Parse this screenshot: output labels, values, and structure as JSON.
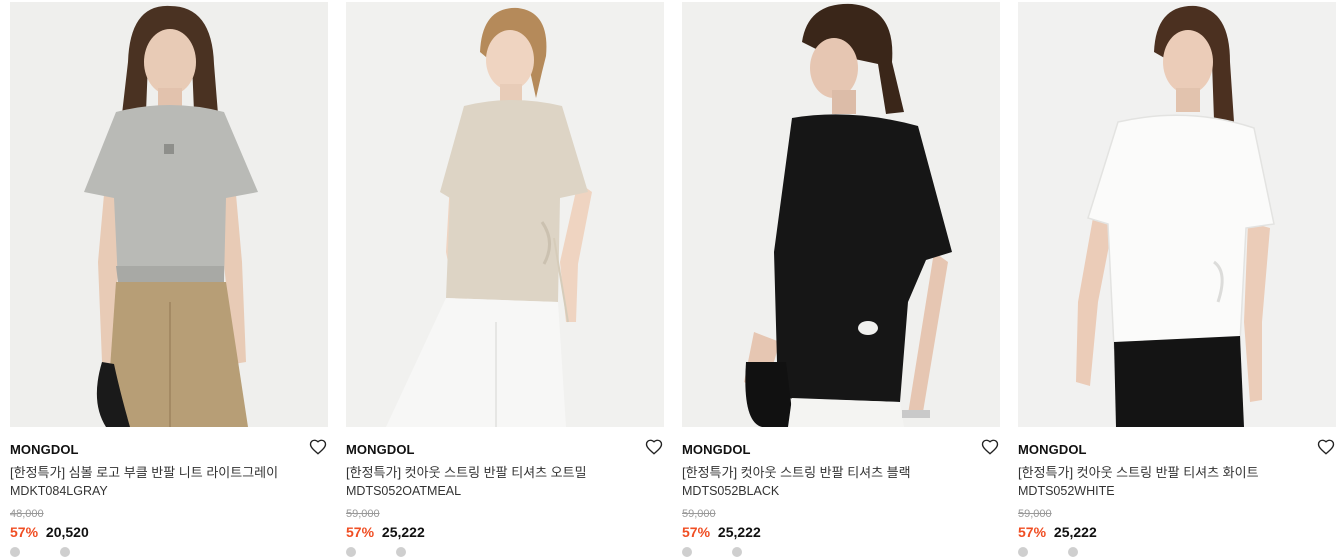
{
  "products": [
    {
      "brand": "MONGDOL",
      "name": "[한정특가] 심볼 로고 부클 반팔 니트 라이트그레이",
      "code": "MDKT084LGRAY",
      "original_price": "48,000",
      "discount": "57%",
      "price": "20,520",
      "photo": {
        "bg": "#efefed",
        "top": "#b9bab6",
        "bottom": "#b79e76",
        "skin": "#e8cbb6",
        "hair": "#4a3222"
      }
    },
    {
      "brand": "MONGDOL",
      "name": "[한정특가] 컷아웃 스트링 반팔 티셔츠 오트밀",
      "code": "MDTS052OATMEAL",
      "original_price": "59,000",
      "discount": "57%",
      "price": "25,222",
      "photo": {
        "bg": "#f1f1ef",
        "top": "#ddd4c5",
        "bottom": "#f7f7f6",
        "skin": "#efd4c1",
        "hair": "#b58a5a"
      }
    },
    {
      "brand": "MONGDOL",
      "name": "[한정특가] 컷아웃 스트링 반팔 티셔츠 블랙",
      "code": "MDTS052BLACK",
      "original_price": "59,000",
      "discount": "57%",
      "price": "25,222",
      "photo": {
        "bg": "#f0f0ee",
        "top": "#161616",
        "bottom": "#f4f4f2",
        "skin": "#e6c6b2",
        "hair": "#3a2619"
      }
    },
    {
      "brand": "MONGDOL",
      "name": "[한정특가] 컷아웃 스트링 반팔 티셔츠 화이트",
      "code": "MDTS052WHITE",
      "original_price": "59,000",
      "discount": "57%",
      "price": "25,222",
      "photo": {
        "bg": "#f1f1f0",
        "top": "#fbfbfa",
        "bottom": "#141414",
        "skin": "#ebccb8",
        "hair": "#4b3020"
      }
    }
  ],
  "icons": {
    "wishlist": "heart-outline-icon"
  },
  "colors": {
    "discount": "#f04e23",
    "original_price": "#999999",
    "text": "#111111"
  }
}
